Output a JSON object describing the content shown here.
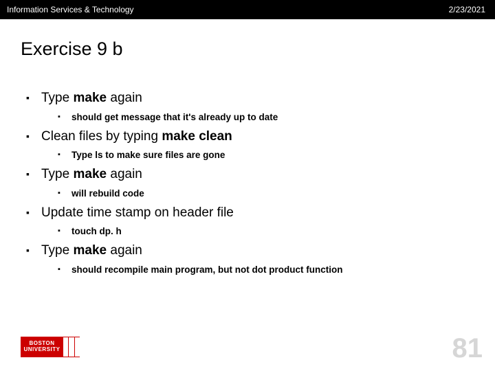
{
  "header": {
    "left": "Information Services & Technology",
    "right": "2/23/2021"
  },
  "title": "Exercise 9 b",
  "items": [
    {
      "pre": "Type ",
      "bold": "make",
      "post": " again",
      "sub": [
        {
          "text": "should get message that it's already up to date"
        }
      ]
    },
    {
      "pre": "Clean files by typing ",
      "bold": "make clean",
      "post": "",
      "sub": [
        {
          "pre": "Type ",
          "bold": "ls",
          "post": " to make sure files are gone"
        }
      ]
    },
    {
      "pre": "Type ",
      "bold": "make",
      "post": " again",
      "sub": [
        {
          "text": "will rebuild code"
        }
      ]
    },
    {
      "pre": "Update time stamp on header file",
      "bold": "",
      "post": "",
      "sub": [
        {
          "text": "touch  dp. h"
        }
      ]
    },
    {
      "pre": "Type ",
      "bold": "make",
      "post": " again",
      "sub": [
        {
          "text": "should recompile main program, but not dot product function"
        }
      ]
    }
  ],
  "pageNumber": "81",
  "logo": {
    "line1": "BOSTON",
    "line2": "UNIVERSITY"
  }
}
